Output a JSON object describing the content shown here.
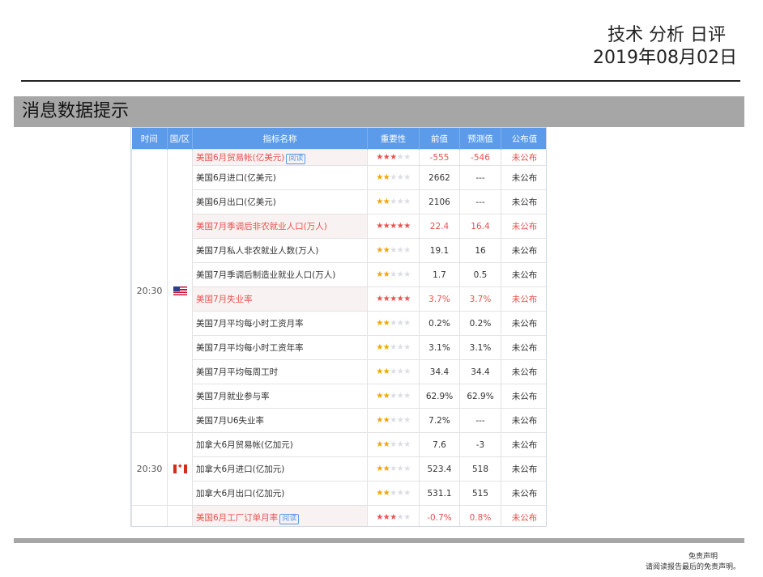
{
  "header": {
    "title": "技术 分析 日评",
    "date": "2019年08月02日"
  },
  "section": {
    "title": "消息数据提示"
  },
  "table": {
    "columns": [
      "时间",
      "国/区",
      "指标名称",
      "重要性",
      "前值",
      "预测值",
      "公布值"
    ],
    "badge_label": "阅读",
    "groups": [
      {
        "time": "20:30",
        "flag": "us-flag-icon"
      },
      {
        "time": "20:30",
        "flag": "canada-flag-icon"
      }
    ],
    "rows": [
      {
        "name": "美国6月贸易帐(亿美元)",
        "stars": 3,
        "prev": "-555",
        "forecast": "-546",
        "actual": "未公布",
        "highlight": true,
        "badge": true
      },
      {
        "name": "美国6月进口(亿美元)",
        "stars": 2,
        "prev": "2662",
        "forecast": "---",
        "actual": "未公布",
        "highlight": false,
        "badge": false
      },
      {
        "name": "美国6月出口(亿美元)",
        "stars": 2,
        "prev": "2106",
        "forecast": "---",
        "actual": "未公布",
        "highlight": false,
        "badge": false
      },
      {
        "name": "美国7月季调后非农就业人口(万人)",
        "stars": 5,
        "prev": "22.4",
        "forecast": "16.4",
        "actual": "未公布",
        "highlight": true,
        "badge": false
      },
      {
        "name": "美国7月私人非农就业人数(万人)",
        "stars": 2,
        "prev": "19.1",
        "forecast": "16",
        "actual": "未公布",
        "highlight": false,
        "badge": false
      },
      {
        "name": "美国7月季调后制造业就业人口(万人)",
        "stars": 2,
        "prev": "1.7",
        "forecast": "0.5",
        "actual": "未公布",
        "highlight": false,
        "badge": false
      },
      {
        "name": "美国7月失业率",
        "stars": 5,
        "prev": "3.7%",
        "forecast": "3.7%",
        "actual": "未公布",
        "highlight": true,
        "badge": false
      },
      {
        "name": "美国7月平均每小时工资月率",
        "stars": 2,
        "prev": "0.2%",
        "forecast": "0.2%",
        "actual": "未公布",
        "highlight": false,
        "badge": false
      },
      {
        "name": "美国7月平均每小时工资年率",
        "stars": 2,
        "prev": "3.1%",
        "forecast": "3.1%",
        "actual": "未公布",
        "highlight": false,
        "badge": false
      },
      {
        "name": "美国7月平均每周工时",
        "stars": 2,
        "prev": "34.4",
        "forecast": "34.4",
        "actual": "未公布",
        "highlight": false,
        "badge": false
      },
      {
        "name": "美国7月就业参与率",
        "stars": 2,
        "prev": "62.9%",
        "forecast": "62.9%",
        "actual": "未公布",
        "highlight": false,
        "badge": false
      },
      {
        "name": "美国7月U6失业率",
        "stars": 2,
        "prev": "7.2%",
        "forecast": "---",
        "actual": "未公布",
        "highlight": false,
        "badge": false
      },
      {
        "name": "加拿大6月贸易帐(亿加元)",
        "stars": 2,
        "prev": "7.6",
        "forecast": "-3",
        "actual": "未公布",
        "highlight": false,
        "badge": false
      },
      {
        "name": "加拿大6月进口(亿加元)",
        "stars": 2,
        "prev": "523.4",
        "forecast": "518",
        "actual": "未公布",
        "highlight": false,
        "badge": false
      },
      {
        "name": "加拿大6月出口(亿加元)",
        "stars": 2,
        "prev": "531.1",
        "forecast": "515",
        "actual": "未公布",
        "highlight": false,
        "badge": false
      },
      {
        "name": "美国6月工厂订单月率",
        "stars": 3,
        "prev": "-0.7%",
        "forecast": "0.8%",
        "actual": "未公布",
        "highlight": true,
        "badge": true
      }
    ]
  },
  "footer": {
    "line1": "免责声明",
    "line2": "请阅读报告最后的免责声明。"
  },
  "colors": {
    "header_blue": "#5b9bea",
    "highlight_red": "#e8524f",
    "star_gold": "#f2a500",
    "section_grey": "#a6a6a6"
  }
}
